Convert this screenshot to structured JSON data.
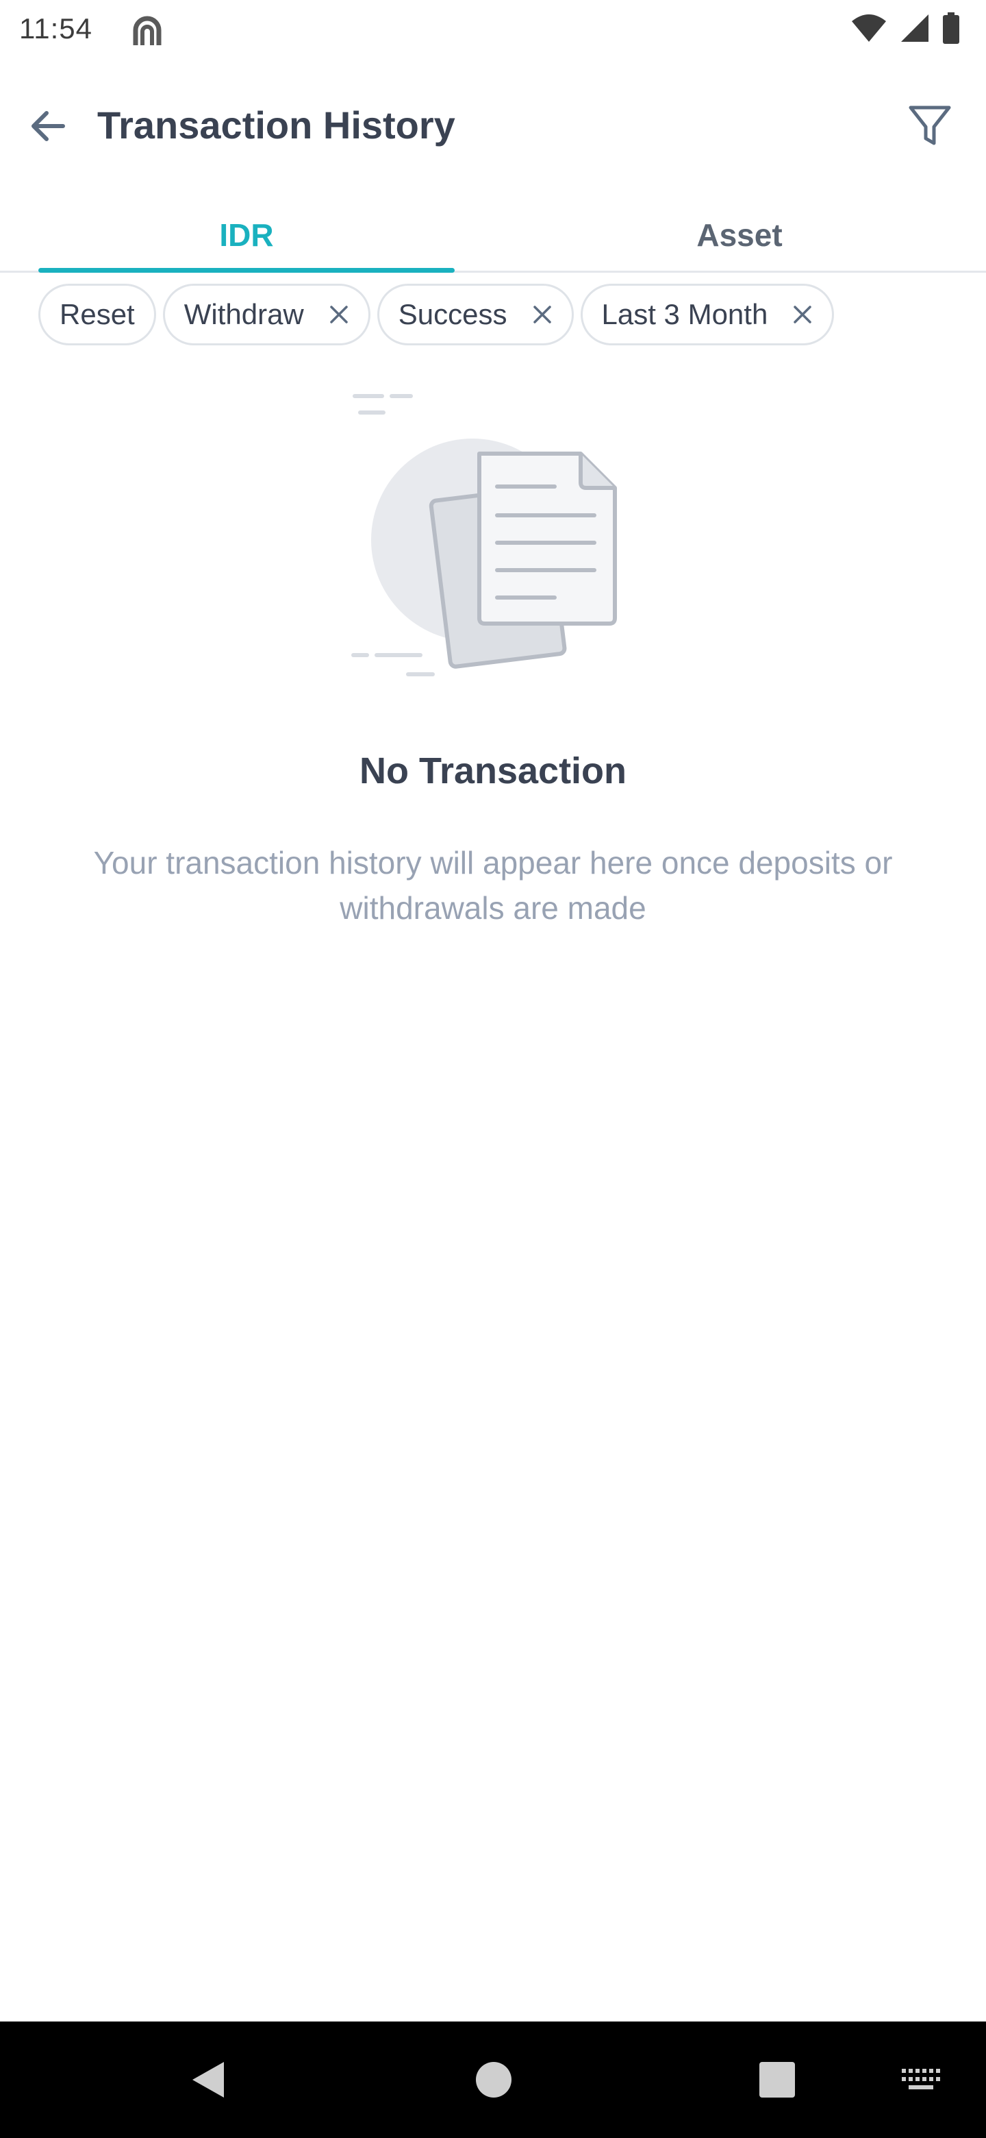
{
  "status_bar": {
    "time": "11:54",
    "icons": [
      "app-notification-icon",
      "wifi-icon",
      "cellular-signal-icon",
      "battery-icon"
    ]
  },
  "app_bar": {
    "title": "Transaction History",
    "back_icon": "arrow-left-icon",
    "filter_icon": "funnel-icon"
  },
  "tabs": [
    {
      "label": "IDR",
      "active": true
    },
    {
      "label": "Asset",
      "active": false
    }
  ],
  "filters": {
    "reset_label": "Reset",
    "chips": [
      {
        "label": "Withdraw"
      },
      {
        "label": "Success"
      },
      {
        "label": "Last 3 Month"
      }
    ]
  },
  "empty_state": {
    "icon": "document-stack-icon",
    "title": "No Transaction",
    "description": "Your transaction history will appear here once deposits or withdrawals are made"
  },
  "colors": {
    "accent": "#1ab1bf",
    "title_text": "#3a4252",
    "muted_text": "#98a2b3",
    "chip_border": "#dfe3e8"
  },
  "nav_bar": {
    "buttons": [
      "back-triangle-icon",
      "home-circle-icon",
      "recents-square-icon",
      "keyboard-icon"
    ]
  }
}
